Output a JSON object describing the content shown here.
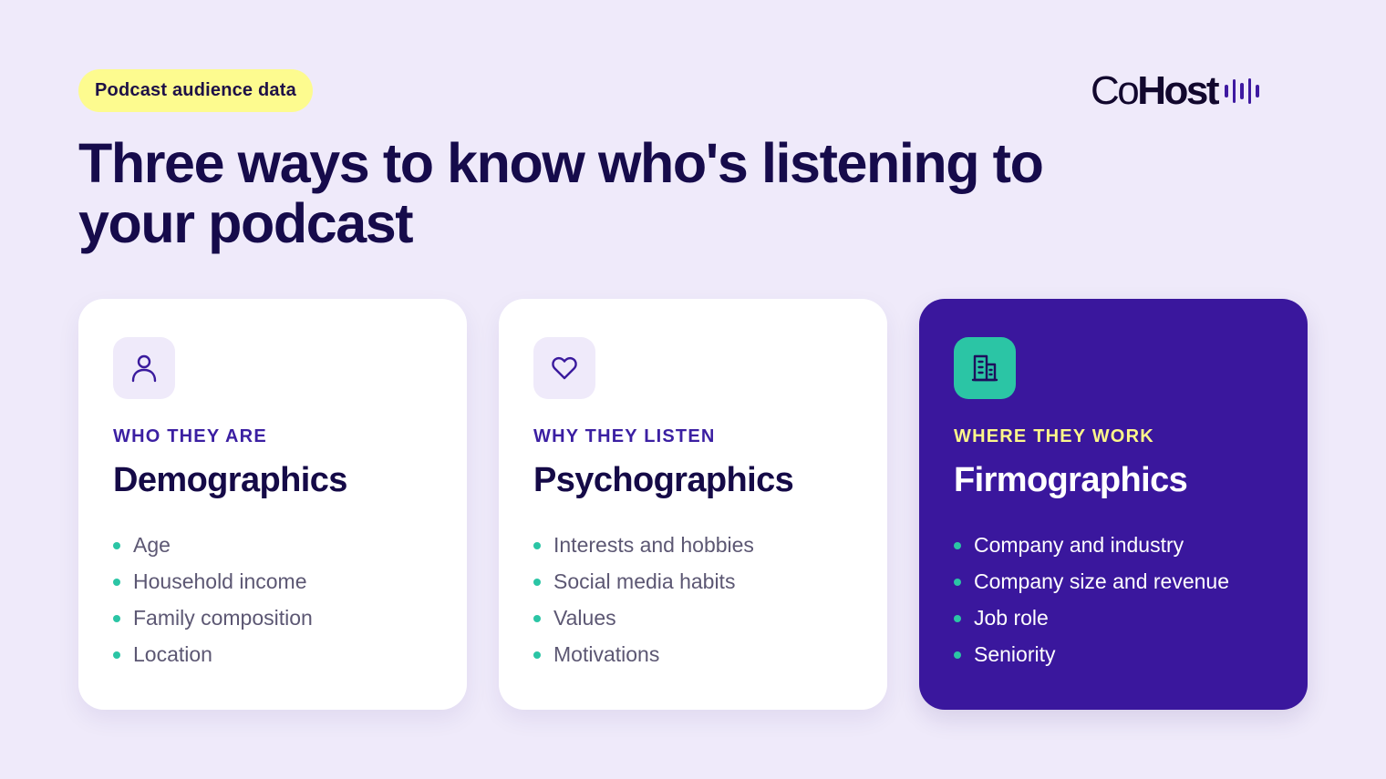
{
  "badge": {
    "label": "Podcast audience data"
  },
  "logo": {
    "co": "Co",
    "host": "Host",
    "icon": "sound-wave-icon",
    "brand_color": "#12082e",
    "accent_color": "#3f1aa1"
  },
  "headline": "Three ways to know who's listening to your podcast",
  "colors": {
    "background": "#efeafa",
    "badge": "#fdfb8f",
    "dark_card": "#3a179d",
    "teal_accent": "#2bc5a5",
    "eyebrow_purple": "#3b1fa2",
    "eyebrow_yellow": "#fdf78a",
    "heading": "#160b4b"
  },
  "cards": [
    {
      "icon": "person-icon",
      "eyebrow": "WHO THEY ARE",
      "title": "Demographics",
      "items": [
        "Age",
        "Household income",
        "Family composition",
        "Location"
      ]
    },
    {
      "icon": "heart-icon",
      "eyebrow": "WHY THEY LISTEN",
      "title": "Psychographics",
      "items": [
        "Interests and hobbies",
        "Social media habits",
        "Values",
        "Motivations"
      ]
    },
    {
      "icon": "building-icon",
      "eyebrow": "WHERE THEY WORK",
      "title": "Firmographics",
      "items": [
        "Company and industry",
        "Company size and revenue",
        "Job role",
        "Seniority"
      ]
    }
  ]
}
